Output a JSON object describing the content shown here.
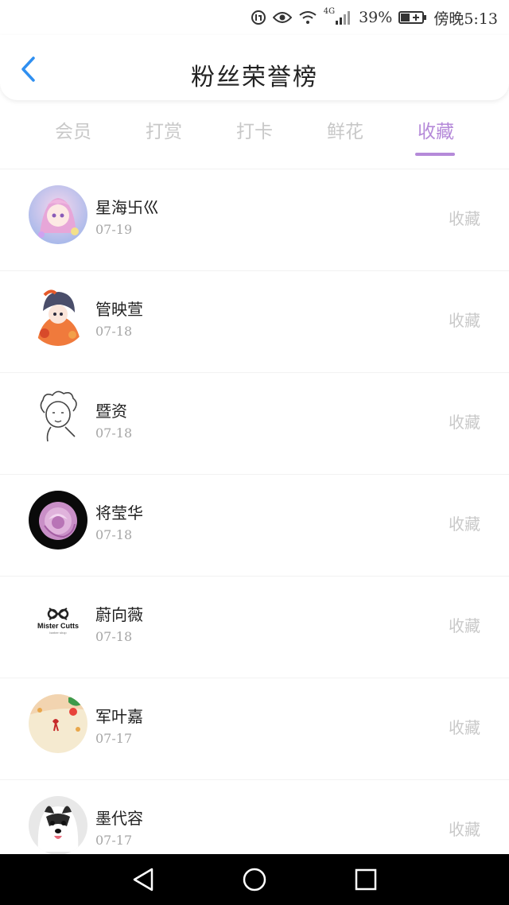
{
  "status_bar": {
    "network": "4G",
    "battery": "39%",
    "time": "傍晚5:13"
  },
  "header": {
    "title": "粉丝荣誉榜",
    "back_icon": "chevron-left-icon",
    "accent_color": "#2f8ff0"
  },
  "tabs": [
    {
      "label": "会员",
      "active": false
    },
    {
      "label": "打赏",
      "active": false
    },
    {
      "label": "打卡",
      "active": false
    },
    {
      "label": "鲜花",
      "active": false
    },
    {
      "label": "收藏",
      "active": true
    }
  ],
  "tab_active_color": "#b58ad9",
  "fans": [
    {
      "name": "星海卐巛",
      "date": "07-19",
      "action": "收藏"
    },
    {
      "name": "管映萱",
      "date": "07-18",
      "action": "收藏"
    },
    {
      "name": "暨资",
      "date": "07-18",
      "action": "收藏"
    },
    {
      "name": "将莹华",
      "date": "07-18",
      "action": "收藏"
    },
    {
      "name": "蔚向薇",
      "date": "07-18",
      "action": "收藏"
    },
    {
      "name": "军叶嘉",
      "date": "07-17",
      "action": "收藏"
    },
    {
      "name": "墨代容",
      "date": "07-17",
      "action": "收藏"
    }
  ],
  "avatars": {
    "mister_cutts_logo": "Mister Cutts",
    "mister_cutts_sub": "barber shop"
  }
}
